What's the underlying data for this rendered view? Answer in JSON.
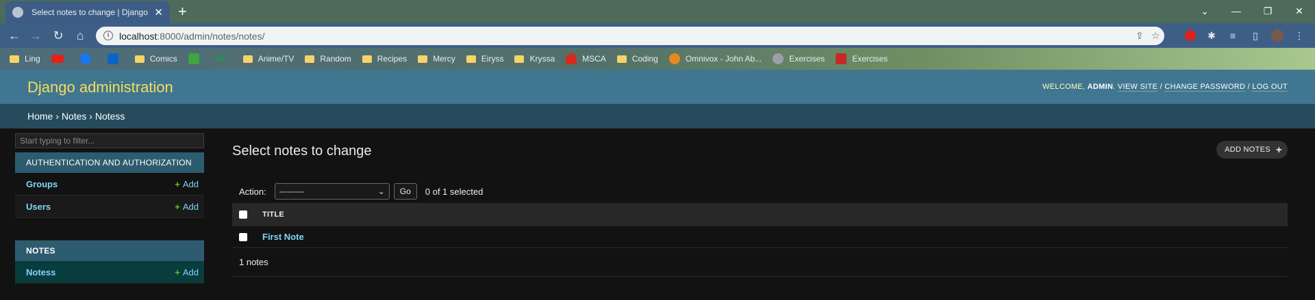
{
  "browser": {
    "tab_title": "Select notes to change | Django",
    "new_tab_label": "+",
    "url_host": "localhost",
    "url_rest": ":8000/admin/notes/notes/",
    "window_controls": [
      "⌄",
      "—",
      "❐",
      "✕"
    ]
  },
  "bookmarks": [
    {
      "label": "Ling",
      "icon": "folder-icon"
    },
    {
      "label": "",
      "icon": "youtube-icon",
      "color": "#e62117"
    },
    {
      "label": "",
      "icon": "facebook-icon",
      "color": "#1877f2"
    },
    {
      "label": "",
      "icon": "outlook-icon",
      "color": "#0a64c8"
    },
    {
      "label": "Comics",
      "icon": "folder-icon"
    },
    {
      "label": "",
      "icon": "id-icon",
      "color": "#3fa53f"
    },
    {
      "label": "",
      "icon": "dragonfly-icon",
      "color": "#2e8b57"
    },
    {
      "label": "Anime/TV",
      "icon": "folder-icon"
    },
    {
      "label": "Random",
      "icon": "folder-icon"
    },
    {
      "label": "Recipes",
      "icon": "folder-icon"
    },
    {
      "label": "Mercy",
      "icon": "folder-icon"
    },
    {
      "label": "Eiryss",
      "icon": "folder-icon"
    },
    {
      "label": "Kryssa",
      "icon": "folder-icon"
    },
    {
      "label": "MSCA",
      "icon": "maple-leaf-icon",
      "color": "#d52b1e"
    },
    {
      "label": "Coding",
      "icon": "folder-icon"
    },
    {
      "label": "Omnivox - John Ab...",
      "icon": "omnivox-icon",
      "color": "#e88a1a"
    },
    {
      "label": "Exercises",
      "icon": "globe-icon",
      "color": "#9aa0a6"
    },
    {
      "label": "Exercises",
      "icon": "book-icon",
      "color": "#c62828"
    }
  ],
  "admin": {
    "brand": "Django administration",
    "welcome": "WELCOME, ",
    "username": "ADMIN",
    "period": ". ",
    "view_site": "VIEW SITE",
    "sep1": " / ",
    "change_password": "CHANGE PASSWORD",
    "sep2": " / ",
    "log_out": "LOG OUT"
  },
  "breadcrumbs": {
    "home": "Home",
    "sep": " › ",
    "app": "Notes",
    "model": "Notess"
  },
  "sidebar": {
    "filter_placeholder": "Start typing to filter...",
    "auth_caption": "AUTHENTICATION AND AUTHORIZATION",
    "groups": "Groups",
    "users": "Users",
    "add": "Add",
    "notes_caption": "NOTES",
    "notess": "Notess"
  },
  "content": {
    "title": "Select notes to change",
    "add_button": "ADD NOTES",
    "action_label": "Action:",
    "action_value": "---------",
    "go": "Go",
    "selected": "0 of 1 selected",
    "column_title": "TITLE",
    "rows": [
      "First Note"
    ],
    "count": "1 notes"
  },
  "colors": {
    "header": "#417690",
    "breadcrumbs": "#264b5d",
    "brand": "#f5dd5d",
    "link": "#81d4fa",
    "add_plus": "#70bf2b"
  }
}
